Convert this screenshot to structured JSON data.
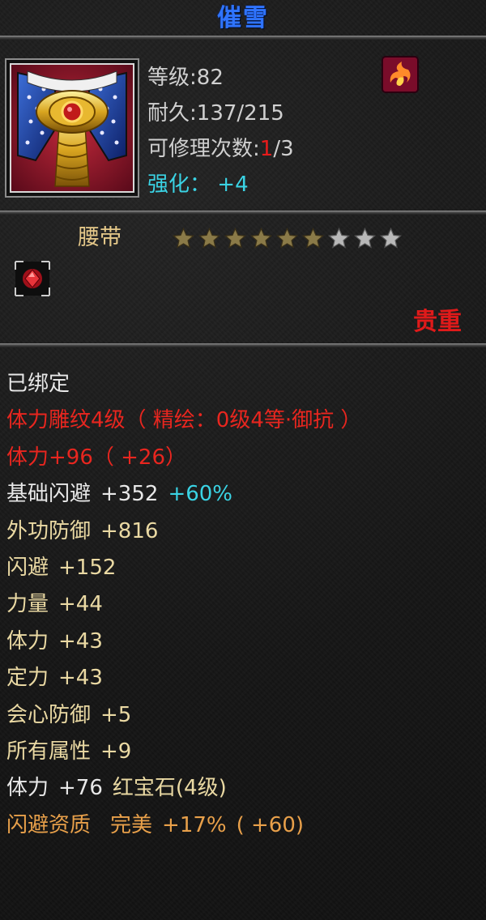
{
  "title": "催雪",
  "item": {
    "level_label": "等级",
    "level_value": "82",
    "durability_label": "耐久",
    "durability_value": "137/215",
    "repair_label": "可修理次数",
    "repair_used": "1",
    "repair_total": "/3",
    "enhance_label": "强化",
    "enhance_value": "+4",
    "type_label": "腰带",
    "stars_total": 9,
    "stars_filled": 6,
    "rarity": "贵重"
  },
  "attributes": {
    "bound": "已绑定",
    "engrave": "体力雕纹4级（ 精绘：0级4等·御抗 ）",
    "vit_main": "体力+96（ +26）",
    "base_dodge_label": "基础闪避",
    "base_dodge_value": "+352",
    "base_dodge_pct": "+60%",
    "ext_def_label": "外功防御",
    "ext_def_value": "+816",
    "dodge_label": "闪避",
    "dodge_value": "+152",
    "power_label": "力量",
    "power_value": "+44",
    "vit_label": "体力",
    "vit_value": "+43",
    "focus_label": "定力",
    "focus_value": "+43",
    "crit_def_label": "会心防御",
    "crit_def_value": "+5",
    "all_attr_label": "所有属性",
    "all_attr_value": "+9",
    "gem_label": "体力",
    "gem_value": "+76",
    "gem_name": "红宝石(4级)",
    "aptitude_label": "闪避资质",
    "aptitude_grade": "完美",
    "aptitude_value": "+17%",
    "aptitude_bonus": "( +60)"
  },
  "colors": {
    "title": "#2f74ff",
    "rarity": "#e01a1a",
    "cyan": "#3ad3e4",
    "gold": "#ead9a3",
    "orange": "#e8a04a",
    "red": "#e8261f"
  },
  "icons": {
    "item_icon": "belt-icon",
    "badge_icon": "flame-swirl-icon",
    "socket_icon": "ruby-gem-icon",
    "star_icon": "star-icon"
  }
}
